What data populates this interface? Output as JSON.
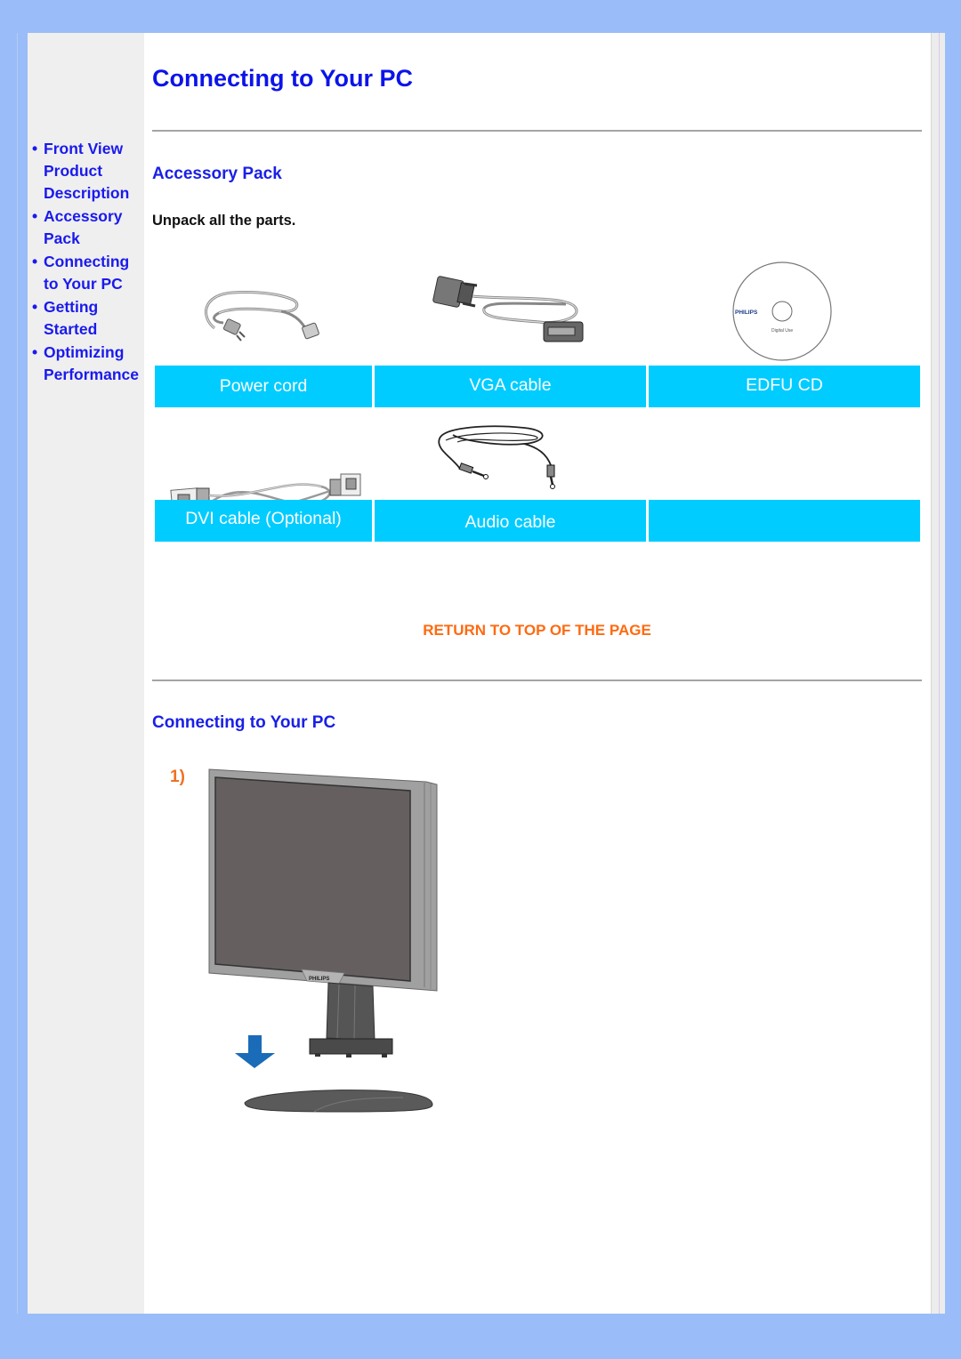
{
  "page": {
    "title": "Connecting to Your PC",
    "background_color": "#9abcf8"
  },
  "sidebar": {
    "items": [
      {
        "lines": [
          "Front View",
          "Product",
          "Description"
        ],
        "label": "Front View Product Description"
      },
      {
        "lines": [
          "Accessory",
          "Pack"
        ],
        "label": "Accessory Pack"
      },
      {
        "lines": [
          "Connecting",
          "to Your PC"
        ],
        "label": "Connecting to Your PC"
      },
      {
        "lines": [
          "Getting",
          "Started"
        ],
        "label": "Getting Started"
      },
      {
        "lines": [
          "Optimizing",
          "Performance"
        ],
        "label": "Optimizing Performance"
      }
    ],
    "bullet": "•"
  },
  "accessory_pack": {
    "heading": "Accessory Pack",
    "intro": "Unpack all the parts.",
    "label_color": "#00ccff",
    "items": [
      {
        "label": "Power cord",
        "icon": "power-cord-image"
      },
      {
        "label": "VGA cable",
        "icon": "vga-cable-image"
      },
      {
        "label": "EDFU CD",
        "icon": "cd-image",
        "cd_brand": "PHILIPS",
        "cd_text": "Digital Use"
      },
      {
        "label": "DVI cable (Optional)",
        "icon": "dvi-cable-image"
      },
      {
        "label": "Audio cable",
        "icon": "audio-cable-image"
      },
      {
        "label": "",
        "icon": ""
      }
    ]
  },
  "return_link": {
    "label": "RETURN TO TOP OF THE PAGE",
    "color": "#ff6a10"
  },
  "connecting": {
    "heading": "Connecting to Your PC",
    "step": "1)",
    "monitor_brand": "PHILIPS",
    "arrow_color": "#1a6bb8"
  }
}
